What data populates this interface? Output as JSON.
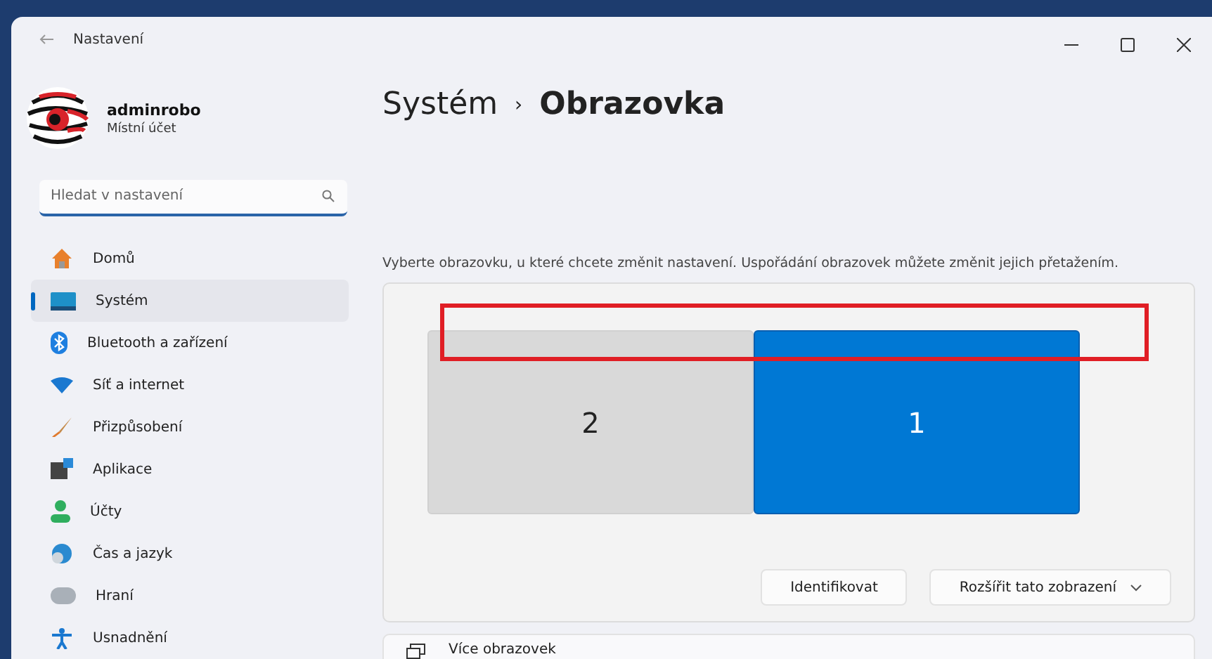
{
  "window": {
    "title": "Nastavení"
  },
  "account": {
    "name": "adminrobo",
    "type": "Místní účet"
  },
  "search": {
    "placeholder": "Hledat v nastavení"
  },
  "sidebar": {
    "items": [
      {
        "label": "Domů",
        "kind": "home",
        "selected": false
      },
      {
        "label": "Systém",
        "kind": "system",
        "selected": true
      },
      {
        "label": "Bluetooth a zařízení",
        "kind": "bluetooth",
        "selected": false
      },
      {
        "label": "Síť a internet",
        "kind": "network",
        "selected": false
      },
      {
        "label": "Přizpůsobení",
        "kind": "brush",
        "selected": false
      },
      {
        "label": "Aplikace",
        "kind": "apps",
        "selected": false
      },
      {
        "label": "Účty",
        "kind": "person",
        "selected": false
      },
      {
        "label": "Čas a jazyk",
        "kind": "globe",
        "selected": false
      },
      {
        "label": "Hraní",
        "kind": "gamepad",
        "selected": false
      },
      {
        "label": "Usnadnění",
        "kind": "accessibility",
        "selected": false
      }
    ]
  },
  "breadcrumb": {
    "parent": "Systém",
    "separator": "›",
    "current": "Obrazovka"
  },
  "description": "Vyberte obrazovku, u které chcete změnit nastavení. Uspořádání obrazovek můžete změnit jejich přetažením.",
  "displays": [
    {
      "label": "2",
      "selected": false
    },
    {
      "label": "1",
      "selected": true
    }
  ],
  "buttons": {
    "identify": "Identifikovat",
    "mode": "Rozšířit tato zobrazení"
  },
  "sections": [
    {
      "title": "Více obrazovek"
    }
  ]
}
